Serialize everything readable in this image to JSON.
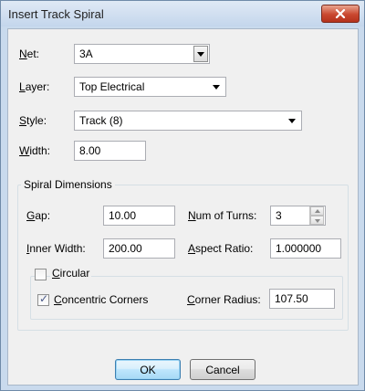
{
  "window": {
    "title": "Insert Track Spiral",
    "close_icon": "close-icon"
  },
  "net": {
    "label_key": "N",
    "label_rest": "et:",
    "value": "3A"
  },
  "layer": {
    "label_key": "L",
    "label_rest": "ayer:",
    "value": "Top Electrical"
  },
  "style": {
    "label_key": "S",
    "label_rest": "tyle:",
    "value": "Track (8)"
  },
  "width": {
    "label_key": "W",
    "label_rest": "idth:",
    "value": "8.00"
  },
  "spiral": {
    "title": "Spiral Dimensions",
    "gap": {
      "label_key": "G",
      "label_rest": "ap:",
      "value": "10.00"
    },
    "turns": {
      "label_key": "N",
      "label_rest": "um of Turns:",
      "value": "3"
    },
    "inner_width": {
      "label_key": "I",
      "label_rest": "nner Width:",
      "value": "200.00"
    },
    "aspect_ratio": {
      "label_key": "A",
      "label_rest": "spect Ratio:",
      "value": "1.000000"
    }
  },
  "circular": {
    "label_key": "C",
    "label_rest": "ircular",
    "checked": false,
    "concentric": {
      "label_key": "C",
      "label_rest": "oncentric Corners",
      "checked": true
    },
    "corner_radius": {
      "label_key": "C",
      "label_rest": "orner Radius:",
      "value": "107.50"
    }
  },
  "buttons": {
    "ok": "OK",
    "cancel": "Cancel"
  }
}
